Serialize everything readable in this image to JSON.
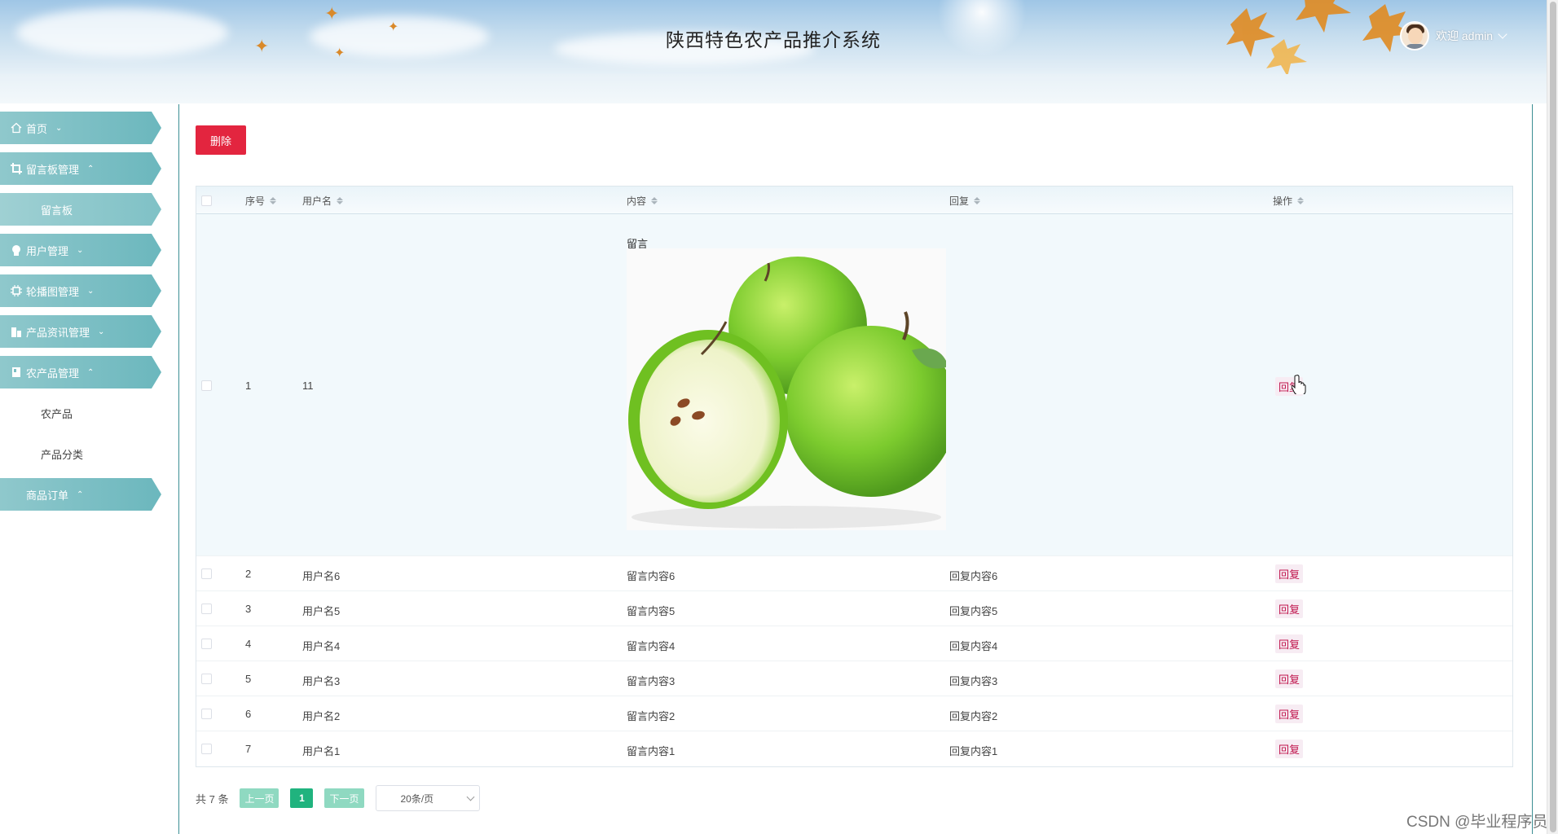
{
  "header": {
    "title": "陕西特色农产品推介系统",
    "welcome": "欢迎 admin"
  },
  "sidebar": {
    "items": [
      {
        "label": "首页",
        "icon": "home-icon",
        "arrow": "⌄"
      },
      {
        "label": "留言板管理",
        "icon": "crop-icon",
        "arrow": "⌃"
      },
      {
        "label": "留言板"
      },
      {
        "label": "用户管理",
        "icon": "user-icon",
        "arrow": "⌄"
      },
      {
        "label": "轮播图管理",
        "icon": "chip-icon",
        "arrow": "⌄"
      },
      {
        "label": "产品资讯管理",
        "icon": "building-icon",
        "arrow": "⌄"
      },
      {
        "label": "农产品管理",
        "icon": "book-icon",
        "arrow": "⌃"
      },
      {
        "label": "农产品"
      },
      {
        "label": "产品分类"
      },
      {
        "label": "商品订单",
        "arrow": "⌃"
      }
    ]
  },
  "toolbar": {
    "delete_label": "删除"
  },
  "table": {
    "columns": [
      "序号",
      "用户名",
      "内容",
      "回复",
      "操作"
    ],
    "rows": [
      {
        "index": "1",
        "username": "11",
        "content": "留言",
        "reply": "",
        "action": "回复"
      },
      {
        "index": "2",
        "username": "用户名6",
        "content": "留言内容6",
        "reply": "回复内容6",
        "action": "回复"
      },
      {
        "index": "3",
        "username": "用户名5",
        "content": "留言内容5",
        "reply": "回复内容5",
        "action": "回复"
      },
      {
        "index": "4",
        "username": "用户名4",
        "content": "留言内容4",
        "reply": "回复内容4",
        "action": "回复"
      },
      {
        "index": "5",
        "username": "用户名3",
        "content": "留言内容3",
        "reply": "回复内容3",
        "action": "回复"
      },
      {
        "index": "6",
        "username": "用户名2",
        "content": "留言内容2",
        "reply": "回复内容2",
        "action": "回复"
      },
      {
        "index": "7",
        "username": "用户名1",
        "content": "留言内容1",
        "reply": "回复内容1",
        "action": "回复"
      }
    ]
  },
  "pagination": {
    "total": "共 7 条",
    "prev": "上一页",
    "current": "1",
    "next": "下一页",
    "page_size": "20条/页"
  },
  "watermark": "CSDN @毕业程序员"
}
